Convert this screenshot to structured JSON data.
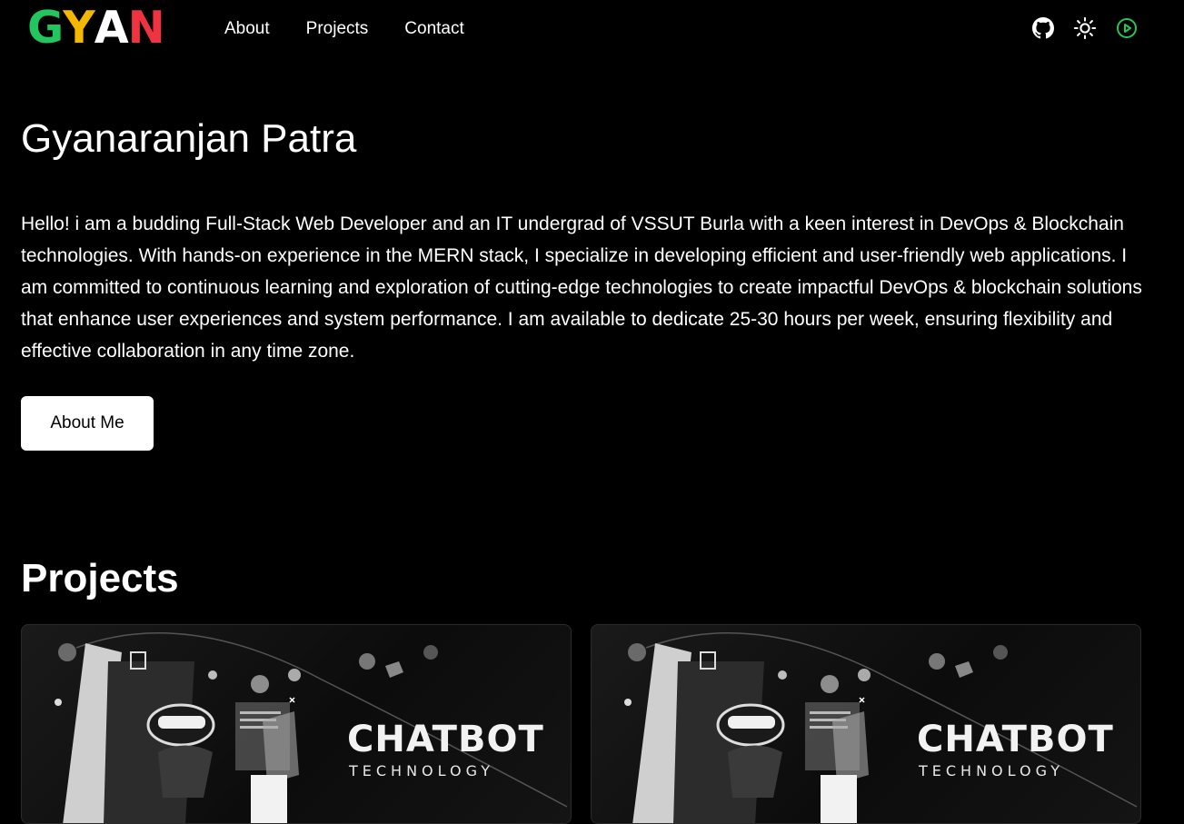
{
  "brand": {
    "letters": [
      "G",
      "Y",
      "A",
      "N"
    ],
    "colors": [
      "#22c55e",
      "#f5b800",
      "#ffffff",
      "#ef3340"
    ]
  },
  "nav": {
    "about": "About",
    "projects": "Projects",
    "contact": "Contact"
  },
  "header_icons": [
    "github-icon",
    "sun-icon",
    "play-circle-icon"
  ],
  "accent_green": "#22c55e",
  "hero": {
    "name": "Gyanaranjan Patra",
    "bio": "Hello! i am a budding Full-Stack Web Developer and an IT undergrad of VSSUT Burla with a keen interest in DevOps & Blockchain technologies. With hands-on experience in the MERN stack, I specialize in developing efficient and user-friendly web applications. I am committed to continuous learning and exploration of cutting-edge technologies to create impactful DevOps & blockchain solutions that enhance user experiences and system performance. I am available to dedicate 25-30 hours per week, ensuring flexibility and effective collaboration in any time zone.",
    "button": "About Me"
  },
  "projects": {
    "heading": "Projects",
    "cards": [
      {
        "title": "CHATBOT",
        "subtitle": "TECHNOLOGY"
      },
      {
        "title": "CHATBOT",
        "subtitle": "TECHNOLOGY"
      }
    ]
  }
}
